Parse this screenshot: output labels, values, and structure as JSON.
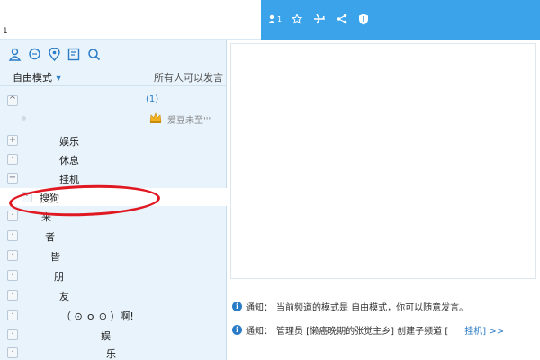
{
  "header": {
    "corner_digit": "1",
    "icons": [
      "user-count-icon",
      "star-icon",
      "plane-icon",
      "share-icon",
      "shield-icon"
    ],
    "user_count_badge": "1"
  },
  "toolbar": {
    "icons": [
      "members-icon",
      "chat-bubble-icon",
      "location-icon",
      "edit-note-icon",
      "search-icon"
    ]
  },
  "mode": {
    "selected": "自由模式",
    "permission": "所有人可以发言"
  },
  "tree": {
    "root_count": "(1)",
    "user_name": "爱豆未至'''",
    "items": [
      {
        "label": "娱乐",
        "toggle": "+"
      },
      {
        "label": "休息",
        "toggle": "·"
      },
      {
        "label": "挂机",
        "toggle": "−"
      },
      {
        "label": "搜狗",
        "toggle": "·"
      },
      {
        "label": "来",
        "toggle": "·"
      },
      {
        "label": "者",
        "toggle": "·"
      },
      {
        "label": "皆",
        "toggle": "·"
      },
      {
        "label": "朋",
        "toggle": "·"
      },
      {
        "label": "友",
        "toggle": "·"
      },
      {
        "label": "（ ⊙ ｏ ⊙ ）啊!",
        "toggle": "·"
      },
      {
        "label": "娱",
        "toggle": "·"
      },
      {
        "label": "乐",
        "toggle": "·"
      }
    ]
  },
  "notices": [
    {
      "prefix": "通知：",
      "text": "当前频道的模式是 自由模式，你可以随意发言。"
    },
    {
      "prefix": "通知：",
      "text": "管理员 [懒癌晚期的张觉主乡] 创建子频道 [",
      "tail": "挂机] >>"
    }
  ],
  "colors": {
    "header_blue": "#3aa3ea",
    "panel_bg": "#e8f3fb",
    "annotation_red": "#e01822",
    "link_blue": "#2a7cc7"
  }
}
